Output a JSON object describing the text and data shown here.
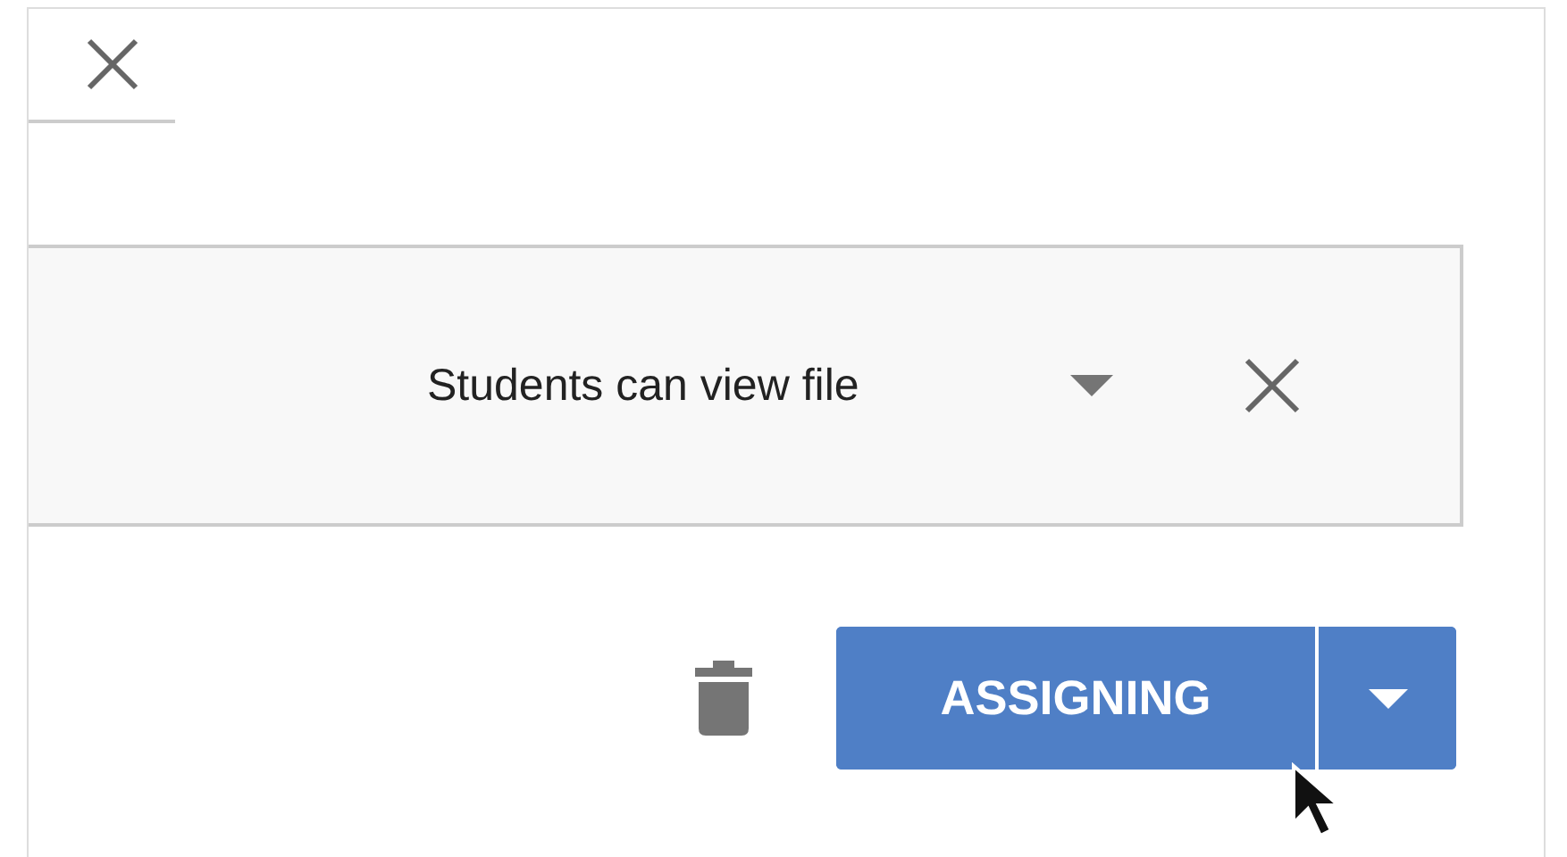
{
  "permission": {
    "label": "Students can view file"
  },
  "assign_button": {
    "label": "ASSIGNING"
  }
}
